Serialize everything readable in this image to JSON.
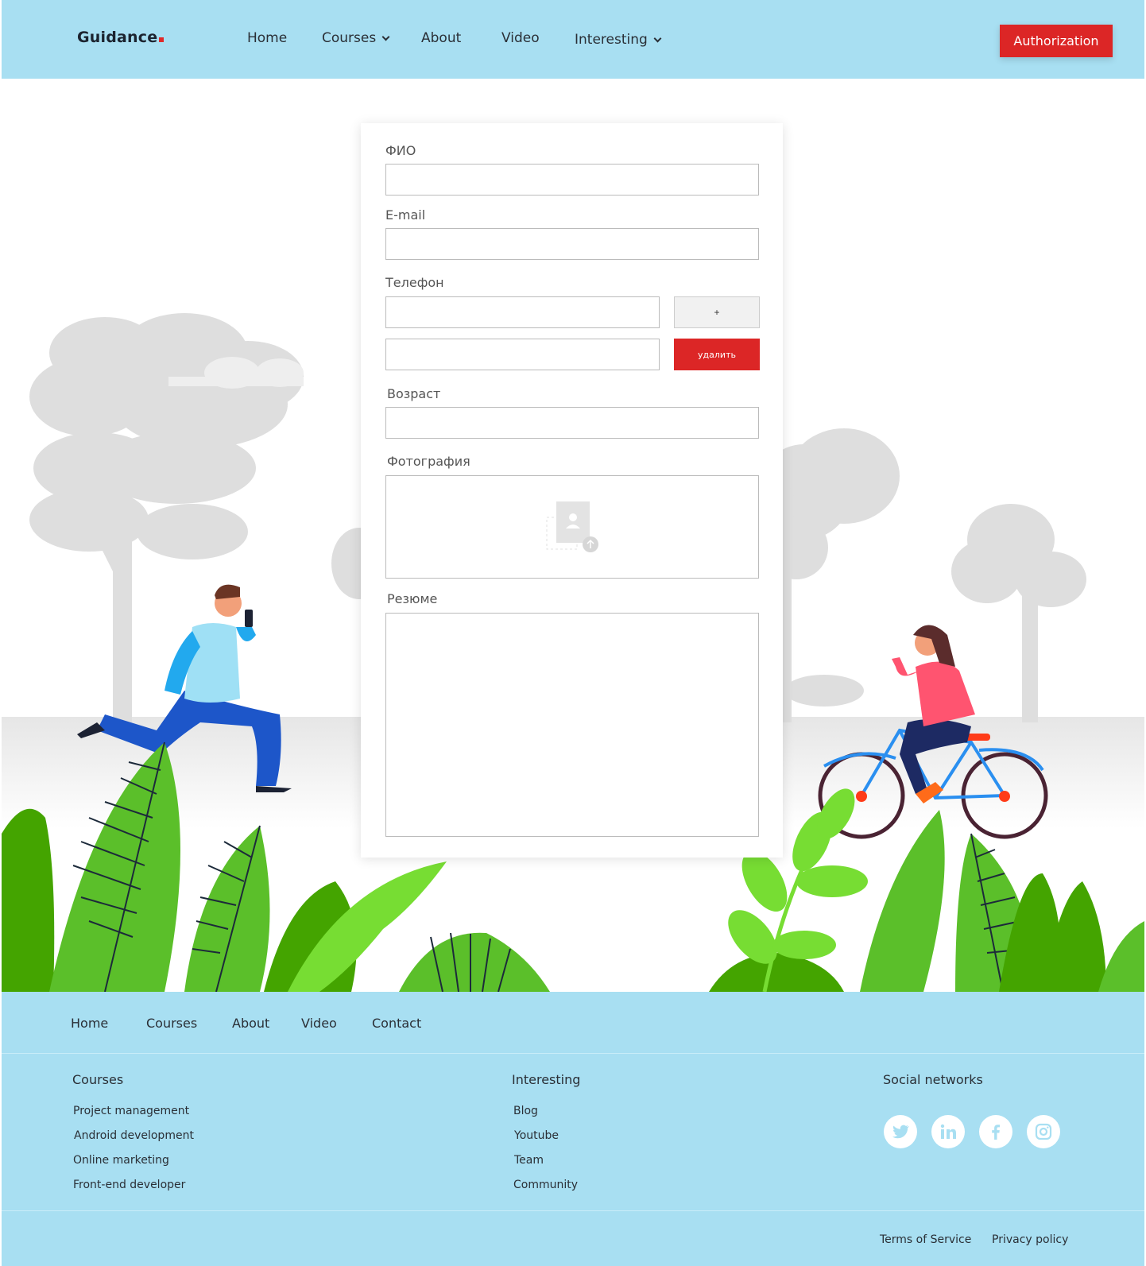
{
  "header": {
    "logo": "Guidance",
    "nav": [
      {
        "label": "Home"
      },
      {
        "label": "Courses"
      },
      {
        "label": "About"
      },
      {
        "label": "Video"
      },
      {
        "label": "Interesting"
      }
    ],
    "auth_label": "Authorization"
  },
  "form": {
    "fio_label": "ФИО",
    "email_label": "E-mail",
    "phone_label": "Телефон",
    "plus_label": "+",
    "delete_label": "удалить",
    "age_label": "Возраст",
    "photo_label": "Фотография",
    "resume_label": "Резюме"
  },
  "footer": {
    "nav": [
      "Home",
      "Courses",
      "About",
      "Video",
      "Contact"
    ],
    "courses": {
      "title": "Courses",
      "items": [
        "Project management",
        "Android development",
        "Online marketing",
        "Front-end developer"
      ]
    },
    "interesting": {
      "title": "Interesting",
      "items": [
        "Blog",
        "Youtube",
        "Team",
        "Community"
      ]
    },
    "social": {
      "title": "Social networks",
      "icons": [
        "twitter-icon",
        "linkedin-icon",
        "facebook-icon",
        "instagram-icon"
      ]
    },
    "terms": "Terms of Service",
    "privacy": "Privacy policy"
  },
  "colors": {
    "header_bg": "#a8dff2",
    "accent_red": "#dc2626",
    "leaf_green": "#5bbf2a"
  }
}
